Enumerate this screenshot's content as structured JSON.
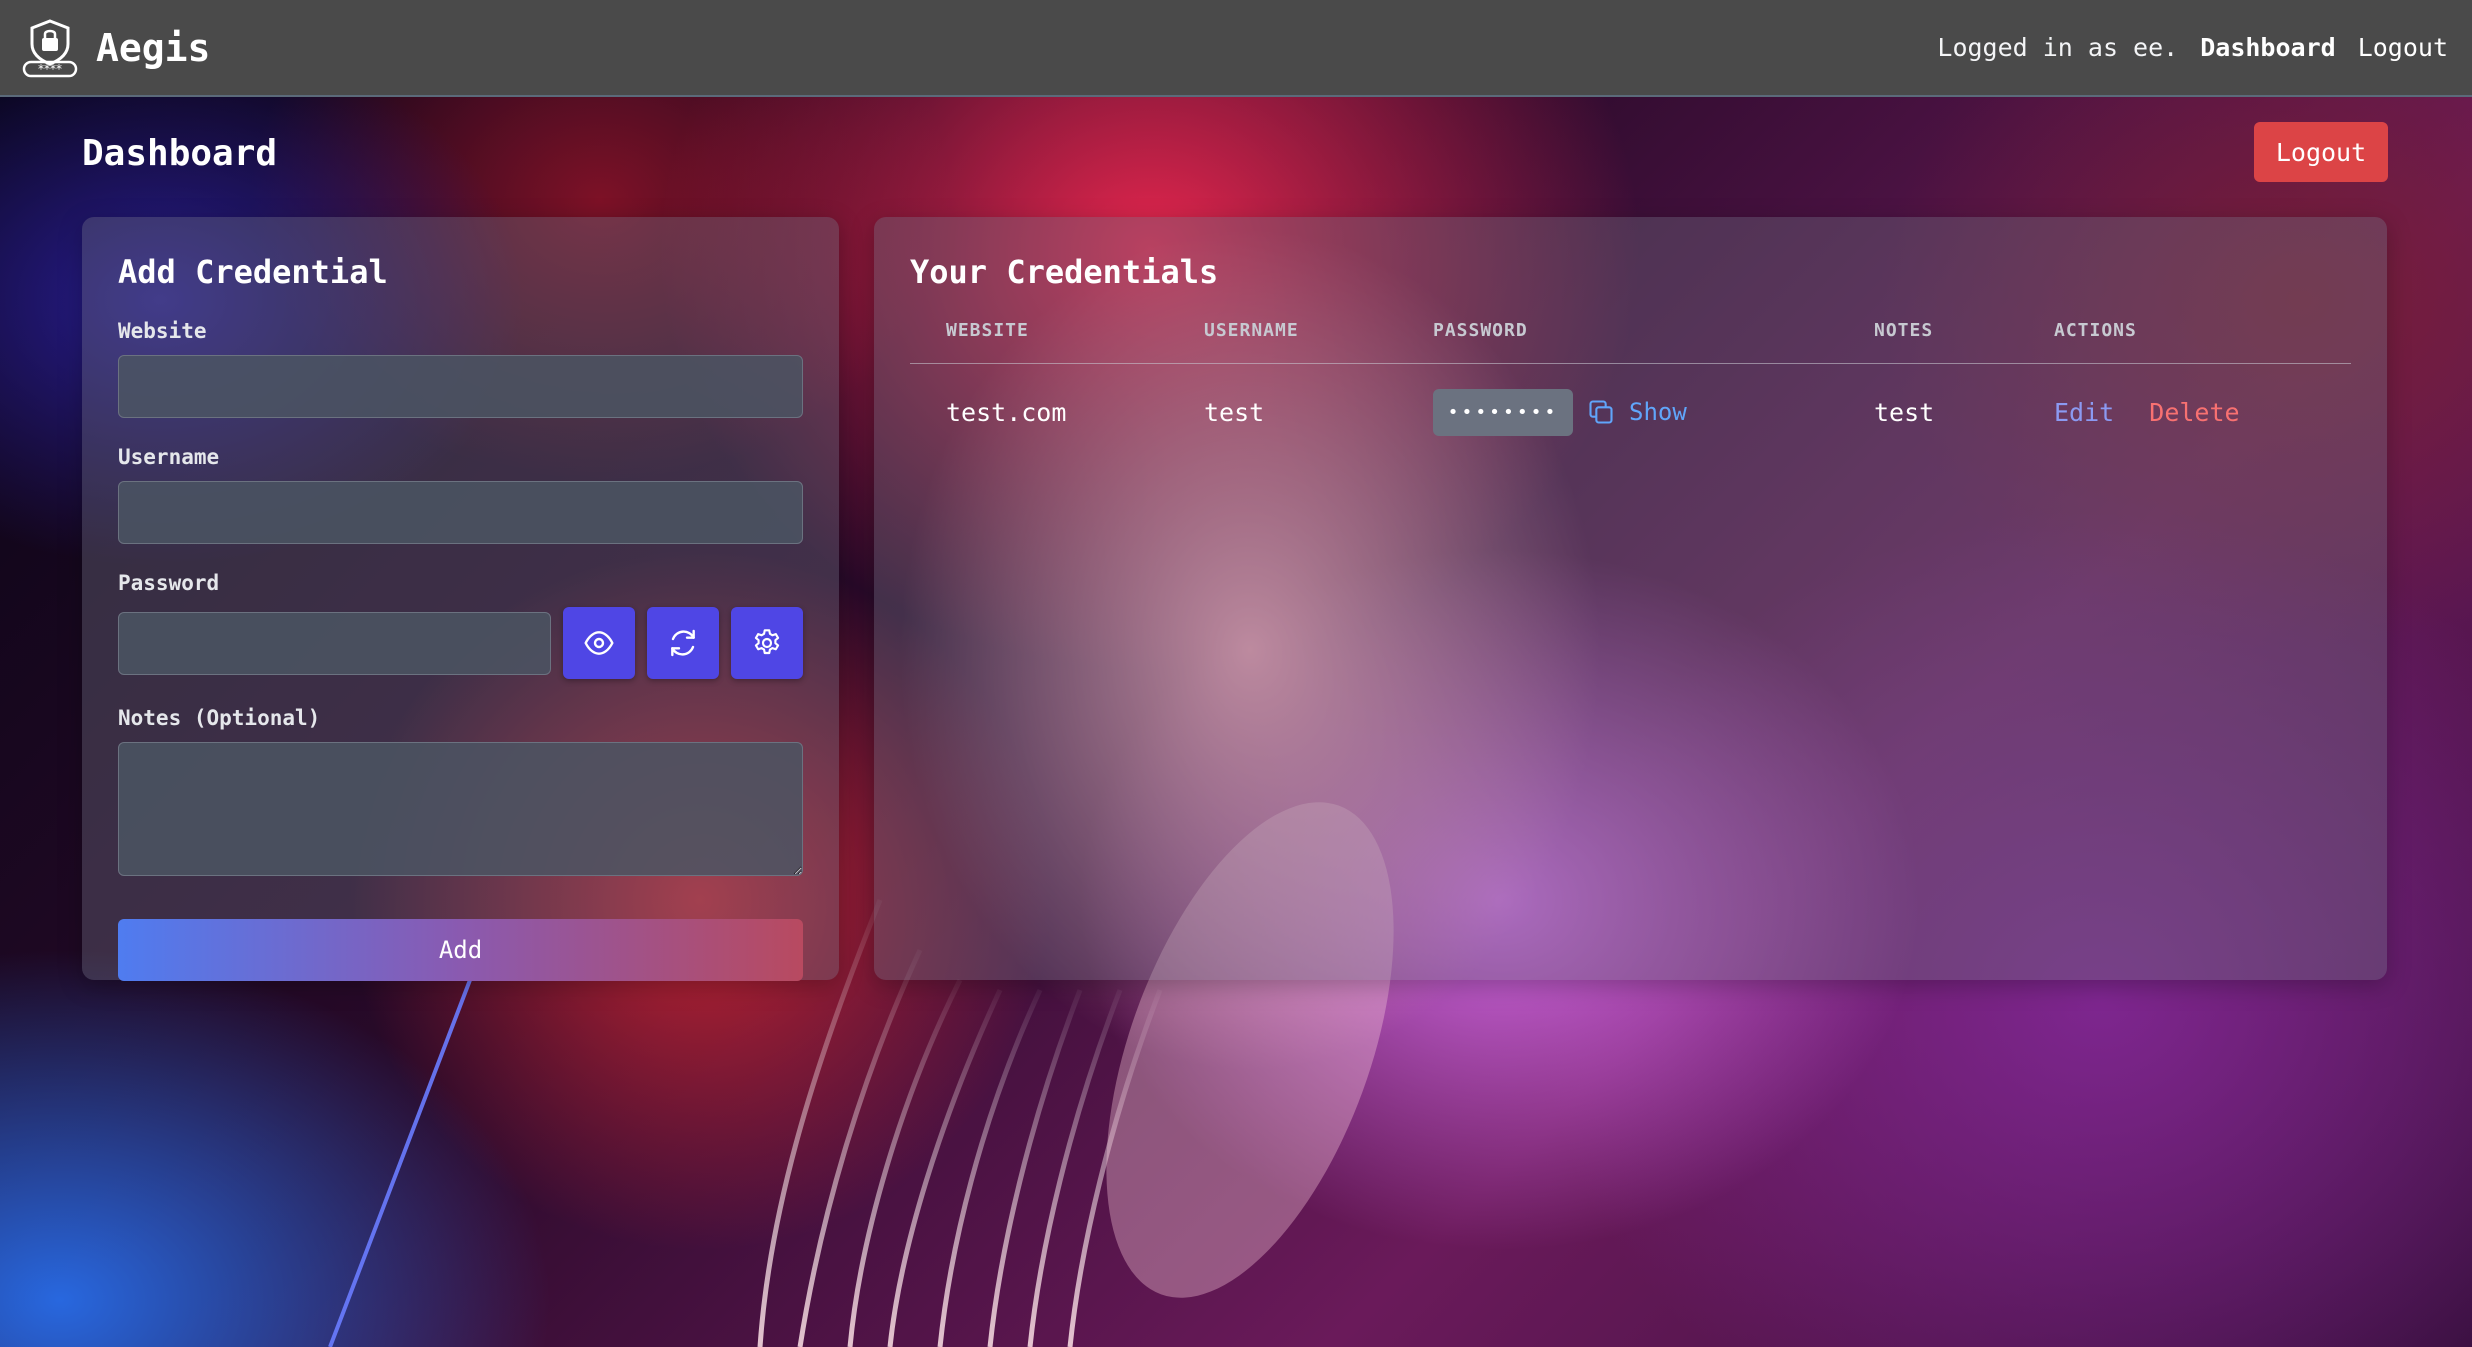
{
  "nav": {
    "brand": "Aegis",
    "status": "Logged in as ee.",
    "links": [
      "Dashboard",
      "Logout"
    ]
  },
  "page": {
    "title": "Dashboard",
    "logout_label": "Logout"
  },
  "add_form": {
    "title": "Add Credential",
    "website_label": "Website",
    "username_label": "Username",
    "password_label": "Password",
    "notes_label": "Notes (Optional)",
    "submit_label": "Add",
    "website_value": "",
    "username_value": "",
    "password_value": "",
    "notes_value": ""
  },
  "credentials": {
    "title": "Your Credentials",
    "columns": [
      "WEBSITE",
      "USERNAME",
      "PASSWORD",
      "NOTES",
      "ACTIONS"
    ],
    "rows": [
      {
        "website": "test.com",
        "username": "test",
        "password_mask": "••••••••",
        "show_label": "Show",
        "notes": "test",
        "edit_label": "Edit",
        "delete_label": "Delete"
      }
    ]
  },
  "colors": {
    "navbar": "#4a4a4a",
    "logout_button": "#dc4446",
    "icon_button": "#4f46e5",
    "show_link": "#60a5fa",
    "edit_link": "#8b9af2",
    "delete_link": "#f87171"
  },
  "icons": [
    "shield-lock-icon",
    "eye-icon",
    "refresh-icon",
    "gear-icon",
    "copy-icon"
  ]
}
